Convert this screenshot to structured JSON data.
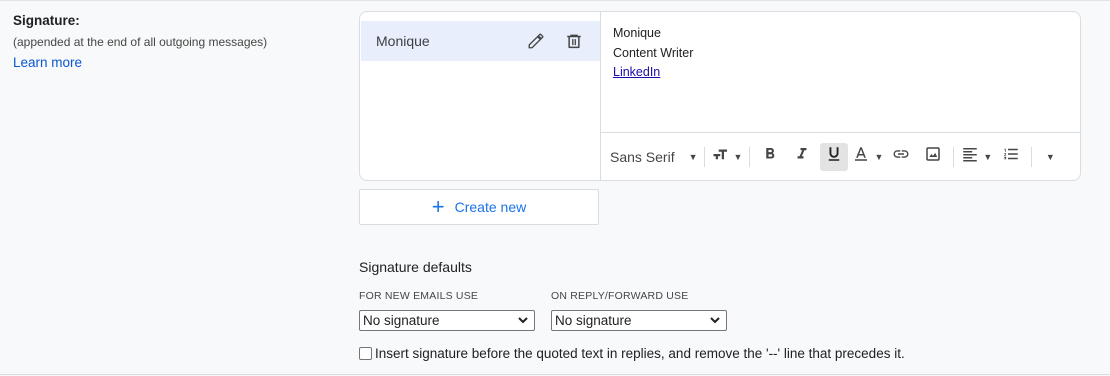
{
  "section": {
    "title": "Signature:",
    "subtitle": "(appended at the end of all outgoing messages)",
    "learn_more": "Learn more"
  },
  "signatures": {
    "items": [
      {
        "name": "Monique",
        "edit_icon": "pencil-icon",
        "delete_icon": "trash-icon",
        "selected": true
      }
    ]
  },
  "editor": {
    "lines": [
      "Monique",
      "Content Writer"
    ],
    "link_text": "LinkedIn"
  },
  "toolbar": {
    "font": "Sans Serif",
    "icons": [
      "text-size-icon",
      "bold-icon",
      "italic-icon",
      "underline-icon",
      "text-color-icon",
      "link-icon",
      "image-icon",
      "align-icon",
      "numbered-list-icon",
      "more-options-icon"
    ],
    "underline_active": true
  },
  "create_new": {
    "label": "Create new",
    "icon": "plus-icon"
  },
  "defaults": {
    "title": "Signature defaults",
    "new_emails_label": "FOR NEW EMAILS USE",
    "new_emails_value": "No signature",
    "reply_label": "ON REPLY/FORWARD USE",
    "reply_value": "No signature"
  },
  "insert_before": {
    "checked": false,
    "label": "Insert signature before the quoted text in replies, and remove the '--' line that precedes it."
  },
  "colors": {
    "accent": "#1a73e8",
    "link": "#0b57d0",
    "selected_bg": "#e8eefc"
  }
}
